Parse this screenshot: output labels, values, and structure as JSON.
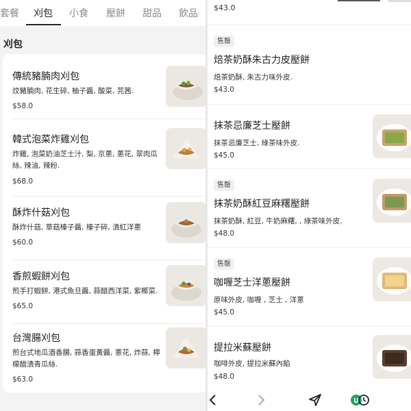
{
  "tabs": [
    {
      "label": "套餐",
      "active": false
    },
    {
      "label": "刈包",
      "active": true
    },
    {
      "label": "小食",
      "active": false
    },
    {
      "label": "壓餅",
      "active": false
    },
    {
      "label": "甜品",
      "active": false
    },
    {
      "label": "飲品",
      "active": false
    }
  ],
  "section_title": "刈包",
  "left_items": [
    {
      "name": "傳統豬腩肉刈包",
      "desc": "炆豬腩肉, 花生碎, 柚子醬, 酸菜, 芫茜.",
      "price": "$58.0"
    },
    {
      "name": "韓式泡菜炸雞刈包",
      "desc": "炸雞, 泡菜奶油芝士汁, 梨, 京蔥, 蔥花, 翠肉瓜絲, 辣油, 辣粉.",
      "price": "$68.0"
    },
    {
      "name": "酥炸什菇刈包",
      "desc": "酥炸什菇, 草菇榛子醬, 榛子碎, 漬紅洋蔥",
      "price": "$60.0"
    },
    {
      "name": "香煎蝦餅刈包",
      "desc": "煎手打蝦餅, 港式魚旦醬, 蒜醋西洋菜, 紫椰菜.",
      "price": "$65.0"
    },
    {
      "name": "台灣腸刈包",
      "desc": "煎台式地瓜酒香腸, 蒜香蛋黃醬, 蔥花, 炸蒜, 檸檬醋漬青瓜絲.",
      "price": "$63.0"
    }
  ],
  "right_top_price": "$43.0",
  "right_items": [
    {
      "badge": "售罄",
      "name": "焙茶奶酥朱古力皮壓餅",
      "desc": "焙茶奶酥, 朱古力味外皮.",
      "price": "$43.0",
      "has_image": false
    },
    {
      "badge": "",
      "name": "抹茶忌廉芝士壓餅",
      "desc": "抹茶忌廉芝士, 綠茶味外皮.",
      "price": "$45.0",
      "has_image": true
    },
    {
      "badge": "售罄",
      "name": "抹茶奶酥紅豆麻糬壓餅",
      "desc": "抹茶奶酥, 紅豆, 牛奶麻糬, , 綠茶味外皮.",
      "price": "$48.0",
      "has_image": true
    },
    {
      "badge": "售罄",
      "name": "咖喱芝士洋蔥壓餅",
      "desc": "原味外皮, 咖喱 , 芝士 , 洋蔥",
      "price": "$45.0",
      "has_image": true
    },
    {
      "badge": "",
      "name": "提拉米蘇壓餅",
      "desc": "咖啡外皮, 提拉米蘇內餡",
      "price": "$48.0",
      "has_image": true
    }
  ],
  "nav_icons": [
    "back-arrow-icon",
    "forward-arrow-icon",
    "share-send-icon",
    "extension-icon"
  ],
  "colors": {
    "accent": "#222222",
    "muted_tab": "#8a8a8a",
    "panel_bg": "#f3f3f3",
    "extension_green": "#1fa463"
  }
}
